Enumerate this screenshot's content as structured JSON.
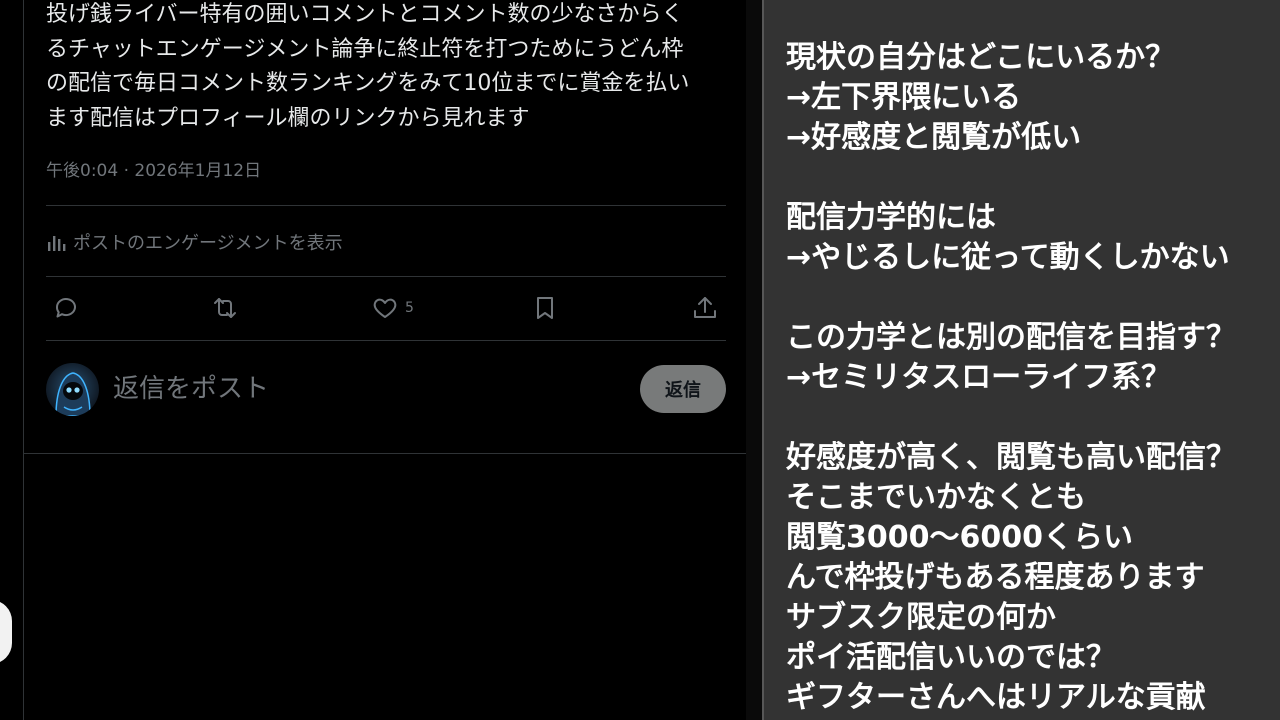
{
  "post": {
    "text": "投げ銭ライバー特有の囲いコメントとコメント数の少なさからく\nるチャットエンゲージメント論争に終止符を打つためにうどん枠\nの配信で毎日コメント数ランキングをみて10位までに賞金を払い\nます配信はプロフィール欄のリンクから見れます",
    "timestamp": "午後0:04 · 2026年1月12日",
    "engagement_label": "ポストのエンゲージメントを表示",
    "like_count": "5"
  },
  "reply": {
    "placeholder": "返信をポスト",
    "button_label": "返信"
  },
  "notes": {
    "lines": [
      "現状の自分はどこにいるか？",
      "→左下界隈にいる",
      "→好感度と閲覧が低い",
      "",
      "配信力学的には",
      "→やじるしに従って動くしかない",
      "",
      "この力学とは別の配信を目指す？",
      "→セミリタスローライフ系？",
      "",
      "好感度が高く、閲覧も高い配信？",
      "そこまでいかなくとも",
      "閲覧3000～6000くらい",
      "んで枠投げもある程度あります",
      "サブスク限定の何か",
      "ポイ活配信いいのでは？",
      "ギフターさんへはリアルな貢献"
    ]
  },
  "icons": {
    "engagement": "bar-chart-icon",
    "reply": "speech-bubble-icon",
    "repost": "repost-icon",
    "like": "heart-icon",
    "bookmark": "bookmark-icon",
    "share": "share-icon",
    "avatar": "hooded-figure-avatar"
  },
  "colors": {
    "background": "#000000",
    "text_primary": "#e7e9ea",
    "text_secondary": "#71767b",
    "divider": "#2f3336",
    "reply_button": "#787a7a",
    "note_panel": "#333333",
    "note_text": "#ffffff",
    "avatar_glow": "#3fb4ff"
  }
}
